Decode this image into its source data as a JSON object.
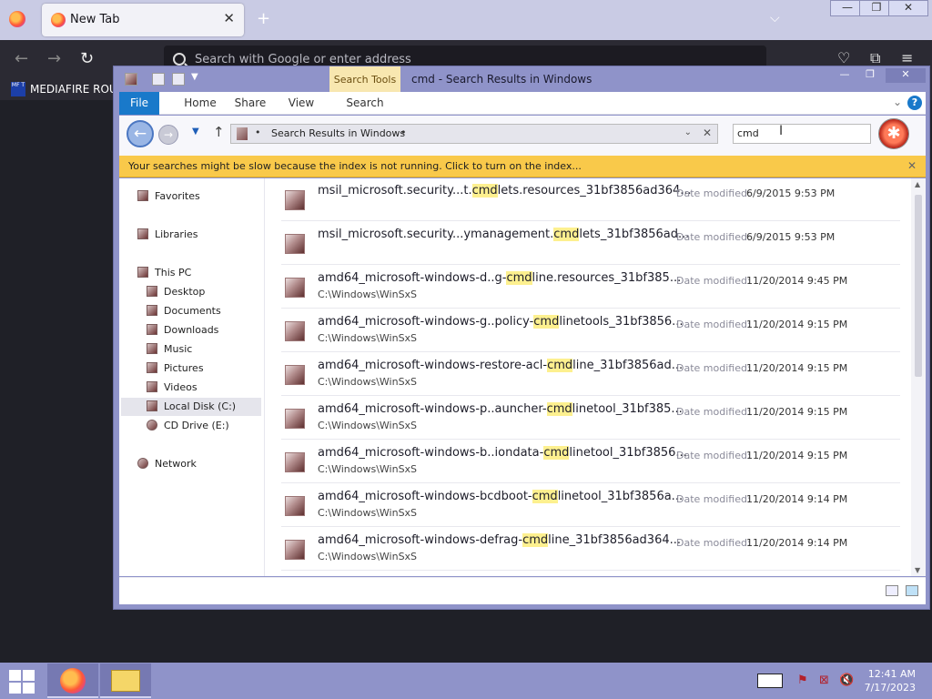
{
  "firefox": {
    "tab_label": "New Tab",
    "tab_close": "✕",
    "new_tab": "+",
    "tab_list": "⌵",
    "win_min": "—",
    "win_max": "❐",
    "win_close": "✕",
    "back": "←",
    "forward": "→",
    "reload": "↻",
    "url_placeholder": "Search with Google or enter address",
    "pocket": "♡",
    "extensions": "⧉",
    "menu": "≡",
    "bookmark_label": "MEDIAFIRE ROUL",
    "bookmark_logo": "MF T"
  },
  "explorer": {
    "title": "cmd - Search Results in Windows",
    "context_tab": "Search Tools",
    "ribbon_tabs": [
      "File",
      "Home",
      "Share",
      "View",
      "Search"
    ],
    "win_min": "—",
    "win_max": "❐",
    "win_close": "✕",
    "help": "?",
    "back": "←",
    "forward": "→",
    "recent": "▼",
    "up": "↑",
    "address_text": "Search Results in Windows",
    "address_dot": "•",
    "address_dropdown": "⌄",
    "address_clear": "✕",
    "search_value": "cmd",
    "search_cursor": "I",
    "search_button": "✱",
    "info_text": "Your searches might be slow because the index is not running.  Click to turn on the index...",
    "info_close": "✕",
    "nav": {
      "favorites": "Favorites",
      "libraries": "Libraries",
      "this_pc": "This PC",
      "desktop": "Desktop",
      "documents": "Documents",
      "downloads": "Downloads",
      "music": "Music",
      "pictures": "Pictures",
      "videos": "Videos",
      "local_disk": "Local Disk (C:)",
      "cd_drive": "CD Drive (E:)",
      "network": "Network"
    },
    "date_label": "Date modified:",
    "scroll_up": "▲",
    "scroll_down": "▼",
    "results": [
      {
        "pre": "msil_microsoft.security...t.",
        "hl": "cmd",
        "post": "lets.resources_31bf3856ad364...",
        "path": "",
        "date": "6/9/2015 9:53 PM"
      },
      {
        "pre": "msil_microsoft.security...ymanagement.",
        "hl": "cmd",
        "post": "lets_31bf3856ad...",
        "path": "",
        "date": "6/9/2015 9:53 PM"
      },
      {
        "pre": "amd64_microsoft-windows-d..g-",
        "hl": "cmd",
        "post": "line.resources_31bf385...",
        "path": "C:\\Windows\\WinSxS",
        "date": "11/20/2014 9:45 PM"
      },
      {
        "pre": "amd64_microsoft-windows-g..policy-",
        "hl": "cmd",
        "post": "linetools_31bf3856...",
        "path": "C:\\Windows\\WinSxS",
        "date": "11/20/2014 9:15 PM"
      },
      {
        "pre": "amd64_microsoft-windows-restore-acl-",
        "hl": "cmd",
        "post": "line_31bf3856ad...",
        "path": "C:\\Windows\\WinSxS",
        "date": "11/20/2014 9:15 PM"
      },
      {
        "pre": "amd64_microsoft-windows-p..auncher-",
        "hl": "cmd",
        "post": "linetool_31bf385...",
        "path": "C:\\Windows\\WinSxS",
        "date": "11/20/2014 9:15 PM"
      },
      {
        "pre": "amd64_microsoft-windows-b..iondata-",
        "hl": "cmd",
        "post": "linetool_31bf3856...",
        "path": "C:\\Windows\\WinSxS",
        "date": "11/20/2014 9:15 PM"
      },
      {
        "pre": "amd64_microsoft-windows-bcdboot-",
        "hl": "cmd",
        "post": "linetool_31bf3856a...",
        "path": "C:\\Windows\\WinSxS",
        "date": "11/20/2014 9:14 PM"
      },
      {
        "pre": "amd64_microsoft-windows-defrag-",
        "hl": "cmd",
        "post": "line_31bf3856ad364...",
        "path": "C:\\Windows\\WinSxS",
        "date": "11/20/2014 9:14 PM"
      }
    ]
  },
  "taskbar": {
    "time": "12:41 AM",
    "date": "7/17/2023",
    "tray_flag": "⚑",
    "tray_network": "⊠",
    "tray_volume": "🔇"
  }
}
